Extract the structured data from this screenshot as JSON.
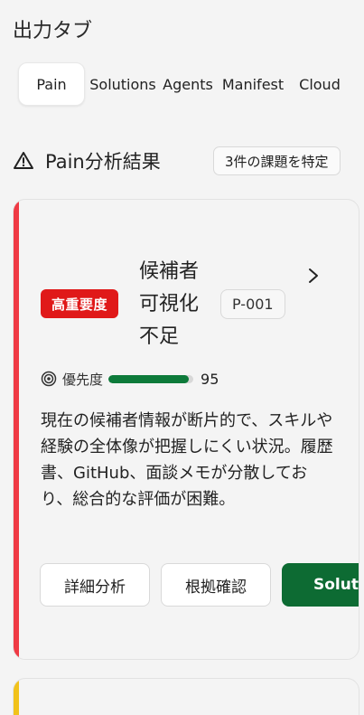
{
  "section": {
    "title": "出力タブ"
  },
  "tabs": [
    {
      "label": "Pain",
      "active": true
    },
    {
      "label": "Solutions"
    },
    {
      "label": "Agents"
    },
    {
      "label": "Manifest"
    },
    {
      "label": "Cloud"
    }
  ],
  "analysis": {
    "title": "Pain分析結果",
    "found_badge": "3件の課題を特定",
    "icon": "warning-triangle-icon"
  },
  "cards": [
    {
      "severity": "高重要度",
      "title": "候補者可視化不足",
      "id": "P-001",
      "priority_label": "優先度",
      "priority_value": "95",
      "priority_fraction": 0.95,
      "description": "現在の候補者情報が断片的で、スキルや経験の全体像が把握しにくい状況。履歴書、GitHub、面談メモが分散しており、総合的な評価が困難。",
      "buttons": {
        "detail": "詳細分析",
        "evidence": "根拠確認",
        "primary": "Solutions"
      },
      "stripe_color": "#ef3a44"
    },
    {
      "stripe_color": "#f1c21b"
    }
  ],
  "colors": {
    "severity_red": "#e01919",
    "priority_green": "#0d7a3a",
    "primary_button": "#0d6b33"
  }
}
